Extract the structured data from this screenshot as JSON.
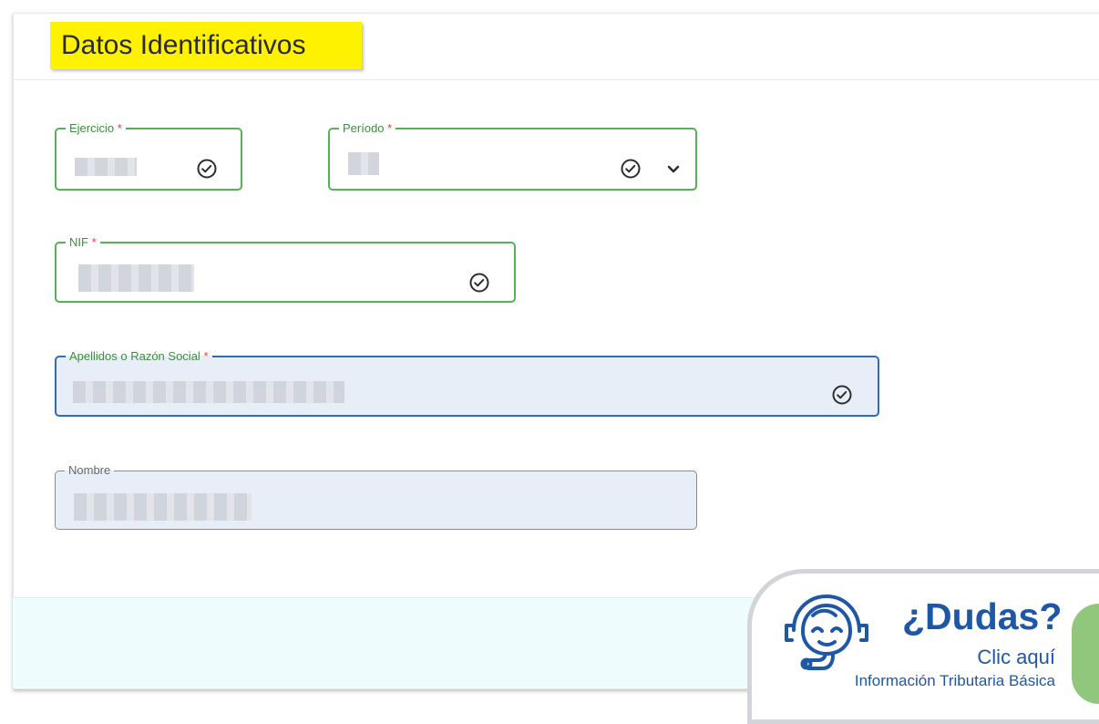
{
  "section": {
    "title": "Datos Identificativos"
  },
  "fields": {
    "ejercicio": {
      "label": "Ejercicio",
      "required": "*",
      "value": ""
    },
    "periodo": {
      "label": "Período",
      "required": "*",
      "value": ""
    },
    "nif": {
      "label": "NIF",
      "required": "*",
      "value": ""
    },
    "apellidos": {
      "label": "Apellidos o Razón Social",
      "required": "*",
      "value": ""
    },
    "nombre": {
      "label": "Nombre",
      "value": ""
    }
  },
  "help": {
    "title": "¿Dudas?",
    "link": "Clic aquí",
    "subtitle": "Información Tributaria Básica"
  },
  "icons": {
    "valid": "check-circle-icon",
    "dropdown": "chevron-down-icon",
    "agent": "headset-agent-icon"
  },
  "colors": {
    "highlight": "#fff200",
    "success": "#57b156",
    "active": "#2f6db5",
    "help_text": "#1f57a7",
    "footer": "#effcfd"
  }
}
